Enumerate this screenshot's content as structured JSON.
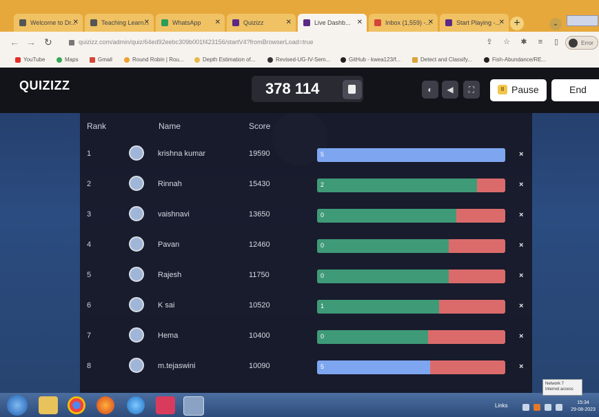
{
  "browser": {
    "tabs": [
      {
        "label": "Welcome to Dr..."
      },
      {
        "label": "Teaching Learn..."
      },
      {
        "label": "WhatsApp"
      },
      {
        "label": "Quizizz"
      },
      {
        "label": "Live Dashb..."
      },
      {
        "label": "Inbox (1,559) -..."
      },
      {
        "label": "Start Playing -..."
      }
    ],
    "url": "quizizz.com/admin/quiz/64ed92eebc309b001f423156/startV4?fromBrowserLoad=true",
    "profile_label": "Error",
    "bookmarks": [
      {
        "label": "YouTube"
      },
      {
        "label": "Maps"
      },
      {
        "label": "Gmail"
      },
      {
        "label": "Round Robin | Rou..."
      },
      {
        "label": "Depth Estimation of..."
      },
      {
        "label": "Revised-UG-IV-Sem..."
      },
      {
        "label": "GitHub - kwea123/f..."
      },
      {
        "label": "Detect and Classify..."
      },
      {
        "label": "Fish-Abundance/RE..."
      }
    ]
  },
  "app": {
    "logo": "QUIZIZZ",
    "game_code": "378 114",
    "pause_label": "Pause",
    "end_label": "End"
  },
  "leaderboard": {
    "headers": {
      "rank": "Rank",
      "name": "Name",
      "score": "Score"
    },
    "rows": [
      {
        "rank": "1",
        "name": "krishna kumar",
        "score": "19590",
        "streak": "5",
        "accuracy": 1.0,
        "bar_color": "#7ea6f0"
      },
      {
        "rank": "2",
        "name": "Rinnah",
        "score": "15430",
        "streak": "2",
        "accuracy": 0.85,
        "bar_color": "#3f9a78"
      },
      {
        "rank": "3",
        "name": "vaishnavi",
        "score": "13650",
        "streak": "0",
        "accuracy": 0.74,
        "bar_color": "#3f9a78"
      },
      {
        "rank": "4",
        "name": "Pavan",
        "score": "12460",
        "streak": "0",
        "accuracy": 0.7,
        "bar_color": "#3f9a78"
      },
      {
        "rank": "5",
        "name": "Rajesh",
        "score": "11750",
        "streak": "0",
        "accuracy": 0.7,
        "bar_color": "#3f9a78"
      },
      {
        "rank": "6",
        "name": "K sai",
        "score": "10520",
        "streak": "1",
        "accuracy": 0.65,
        "bar_color": "#3f9a78"
      },
      {
        "rank": "7",
        "name": "Hema",
        "score": "10400",
        "streak": "0",
        "accuracy": 0.59,
        "bar_color": "#3f9a78"
      },
      {
        "rank": "8",
        "name": "m.tejaswini",
        "score": "10090",
        "streak": "5",
        "accuracy": 0.6,
        "bar_color": "#7ea6f0"
      }
    ],
    "remove_glyph": "×"
  },
  "taskbar": {
    "links_label": "Links",
    "time": "15:34",
    "date": "29-08-2023",
    "network_tooltip_line1": "Network 7",
    "network_tooltip_line2": "Internet access"
  }
}
